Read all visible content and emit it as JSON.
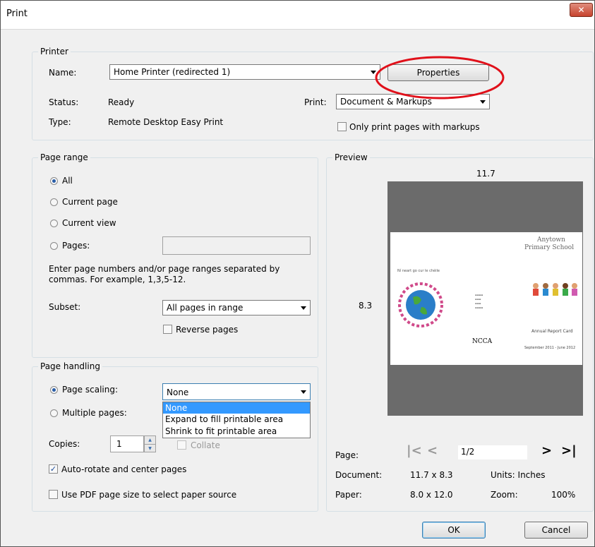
{
  "window": {
    "title": "Print"
  },
  "printer": {
    "group_label": "Printer",
    "name_label": "Name:",
    "name_value": "Home Printer (redirected 1)",
    "properties_label": "Properties",
    "status_label": "Status:",
    "status_value": "Ready",
    "type_label": "Type:",
    "type_value": "Remote Desktop Easy Print",
    "print_label": "Print:",
    "print_value": "Document & Markups",
    "only_markups_label": "Only print pages with markups"
  },
  "page_range": {
    "group_label": "Page range",
    "all": "All",
    "current_page": "Current page",
    "current_view": "Current view",
    "pages": "Pages:",
    "pages_value": "",
    "help_text": "Enter page numbers and/or page ranges separated by commas. For example, 1,3,5-12.",
    "subset_label": "Subset:",
    "subset_value": "All pages in range",
    "reverse_label": "Reverse pages"
  },
  "page_handling": {
    "group_label": "Page handling",
    "page_scaling": "Page scaling:",
    "scaling_value": "None",
    "scaling_options": [
      "None",
      "Expand to fill printable area",
      "Shrink to fit printable area"
    ],
    "multiple_pages": "Multiple pages:",
    "copies_label": "Copies:",
    "copies_value": "1",
    "collate_label": "Collate",
    "auto_rotate_label": "Auto-rotate and center pages",
    "pdf_size_label": "Use PDF page size to select paper source"
  },
  "preview": {
    "group_label": "Preview",
    "width_label": "11.7",
    "height_label": "8.3",
    "thumb": {
      "school_line1": "Anytown",
      "school_line2": "Primary School",
      "motto": "Ní neart go cur le chéile",
      "report": "Annual Report Card",
      "dates": "September 2011 - June 2012",
      "logo": "NCCA"
    },
    "page_label": "Page:",
    "page_value": "1/2",
    "document_label": "Document:",
    "document_value": "11.7 x 8.3",
    "units_label": "Units: Inches",
    "paper_label": "Paper:",
    "paper_value": "8.0 x 12.0",
    "zoom_label": "Zoom:",
    "zoom_value": "100%"
  },
  "footer": {
    "ok": "OK",
    "cancel": "Cancel"
  },
  "colors": {
    "annotation": "#e0101a",
    "selection": "#3399ff"
  }
}
